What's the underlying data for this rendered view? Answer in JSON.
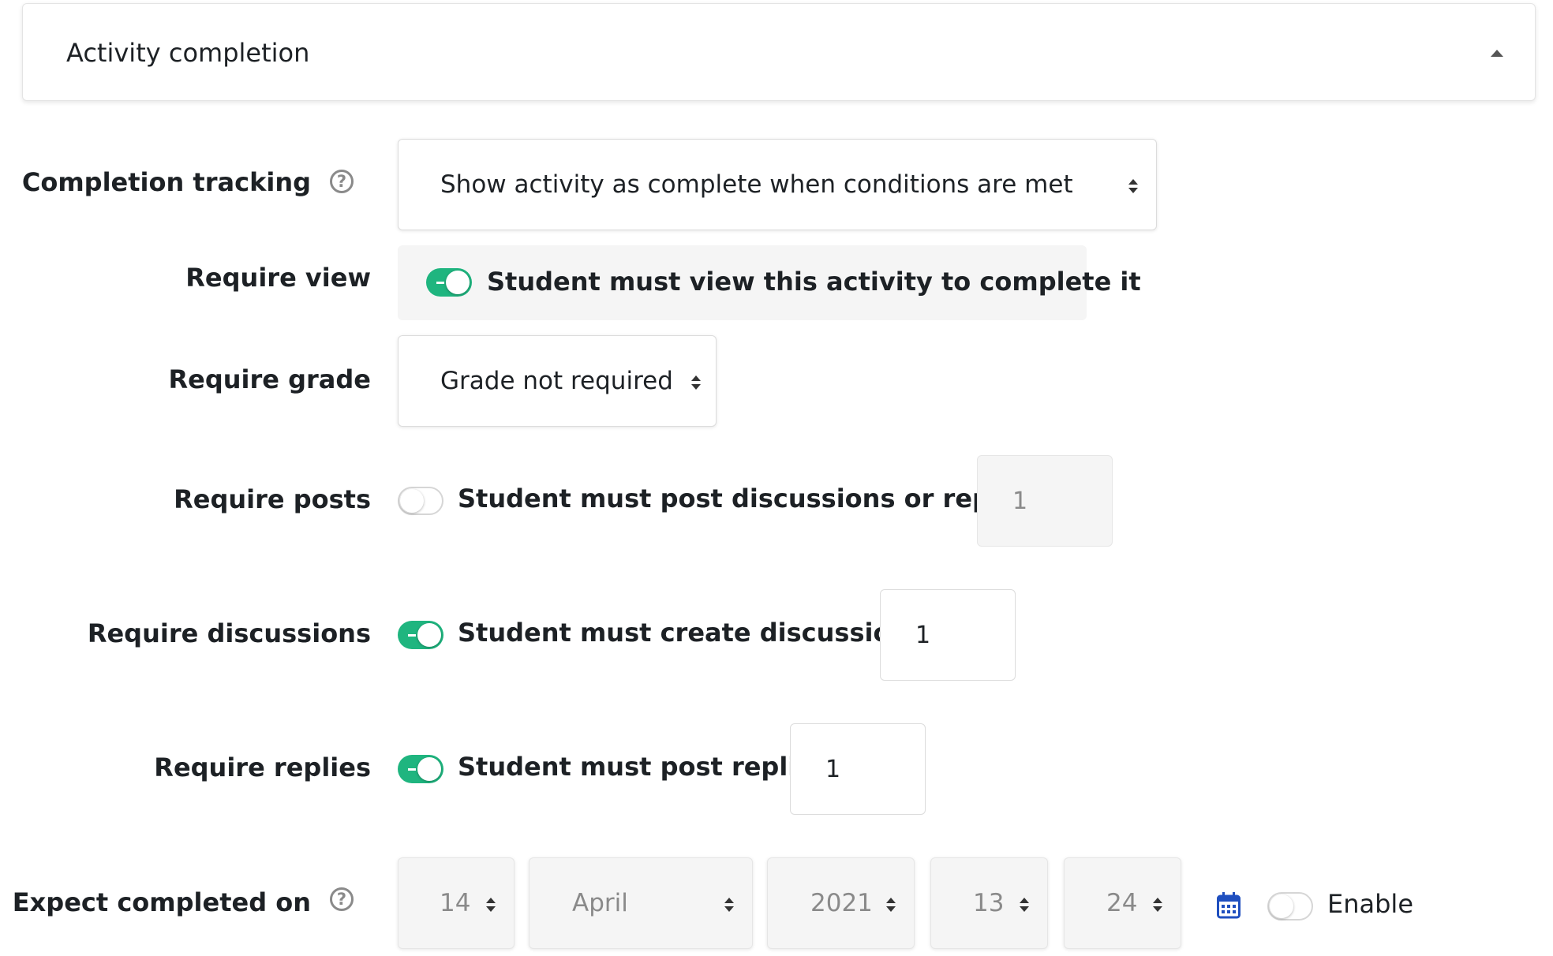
{
  "section": {
    "title": "Activity completion"
  },
  "completion_tracking": {
    "label": "Completion tracking",
    "help_glyph": "?",
    "selected": "Show activity as complete when conditions are met"
  },
  "require_view": {
    "label": "Require view",
    "checked": true,
    "text": "Student must view this activity to complete it"
  },
  "require_grade": {
    "label": "Require grade",
    "selected": "Grade not required"
  },
  "require_posts": {
    "label": "Require posts",
    "checked": false,
    "text": "Student must post discussions or replies:",
    "value": "1"
  },
  "require_discussions": {
    "label": "Require discussions",
    "checked": true,
    "text": "Student must create discussions:",
    "value": "1"
  },
  "require_replies": {
    "label": "Require replies",
    "checked": true,
    "text": "Student must post replies:",
    "value": "1"
  },
  "expect_completed": {
    "label": "Expect completed on",
    "help_glyph": "?",
    "day": "14",
    "month": "April",
    "year": "2021",
    "hour": "13",
    "minute": "24",
    "enable_checked": false,
    "enable_label": "Enable"
  },
  "colors": {
    "toggle_on": "#1fb57f",
    "calendar_icon": "#1f4fbf"
  }
}
